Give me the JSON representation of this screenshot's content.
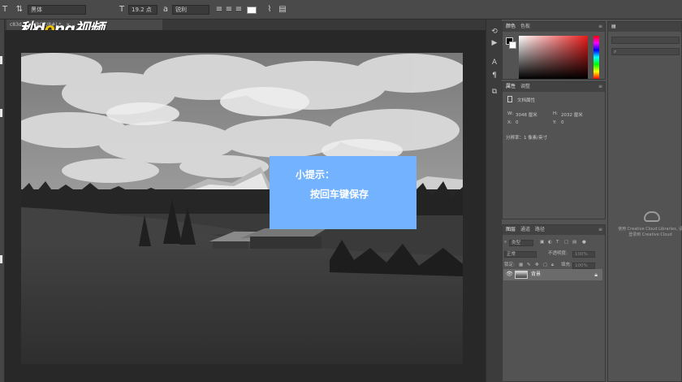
{
  "options_bar": {
    "font_family": "黑体",
    "font_size": "19.2 点",
    "antialias": "锐利"
  },
  "document": {
    "tab_label": "c83d...9%(RGB/8#) *",
    "tab_close": "×",
    "watermark": {
      "part1": "秒d",
      "o": "o",
      "part2": "ng视频"
    }
  },
  "tip": {
    "title": "小提示：",
    "body": "按回车键保存"
  },
  "color_panel": {
    "tabs": [
      "颜色",
      "色板"
    ],
    "foreground": "#000000",
    "background": "#ffffff",
    "hue": "#e81b1b"
  },
  "properties_panel": {
    "tabs": [
      "属性",
      "调整"
    ],
    "section": "文档属性",
    "w_label": "W:",
    "w_value": "3048 厘米",
    "h_label": "H:",
    "h_value": "2032 厘米",
    "x_label": "X:",
    "x_value": "0",
    "y_label": "Y:",
    "y_value": "0",
    "resolution": "分辨率：1 像素/英寸"
  },
  "layers_panel": {
    "tabs": [
      "图层",
      "通道",
      "路径"
    ],
    "filter_label": "类型",
    "blend_mode": "正常",
    "opacity_label": "不透明度:",
    "opacity_value": "100%",
    "lock_label": "锁定:",
    "fill_label": "填充:",
    "fill_value": "100%",
    "layers": [
      {
        "name": "背景",
        "visible": true,
        "locked": true
      }
    ]
  },
  "libraries_panel": {
    "search_icon": "search-icon",
    "message": "使用 Creative Cloud Libraries, 请登录到 Creative Cloud"
  }
}
